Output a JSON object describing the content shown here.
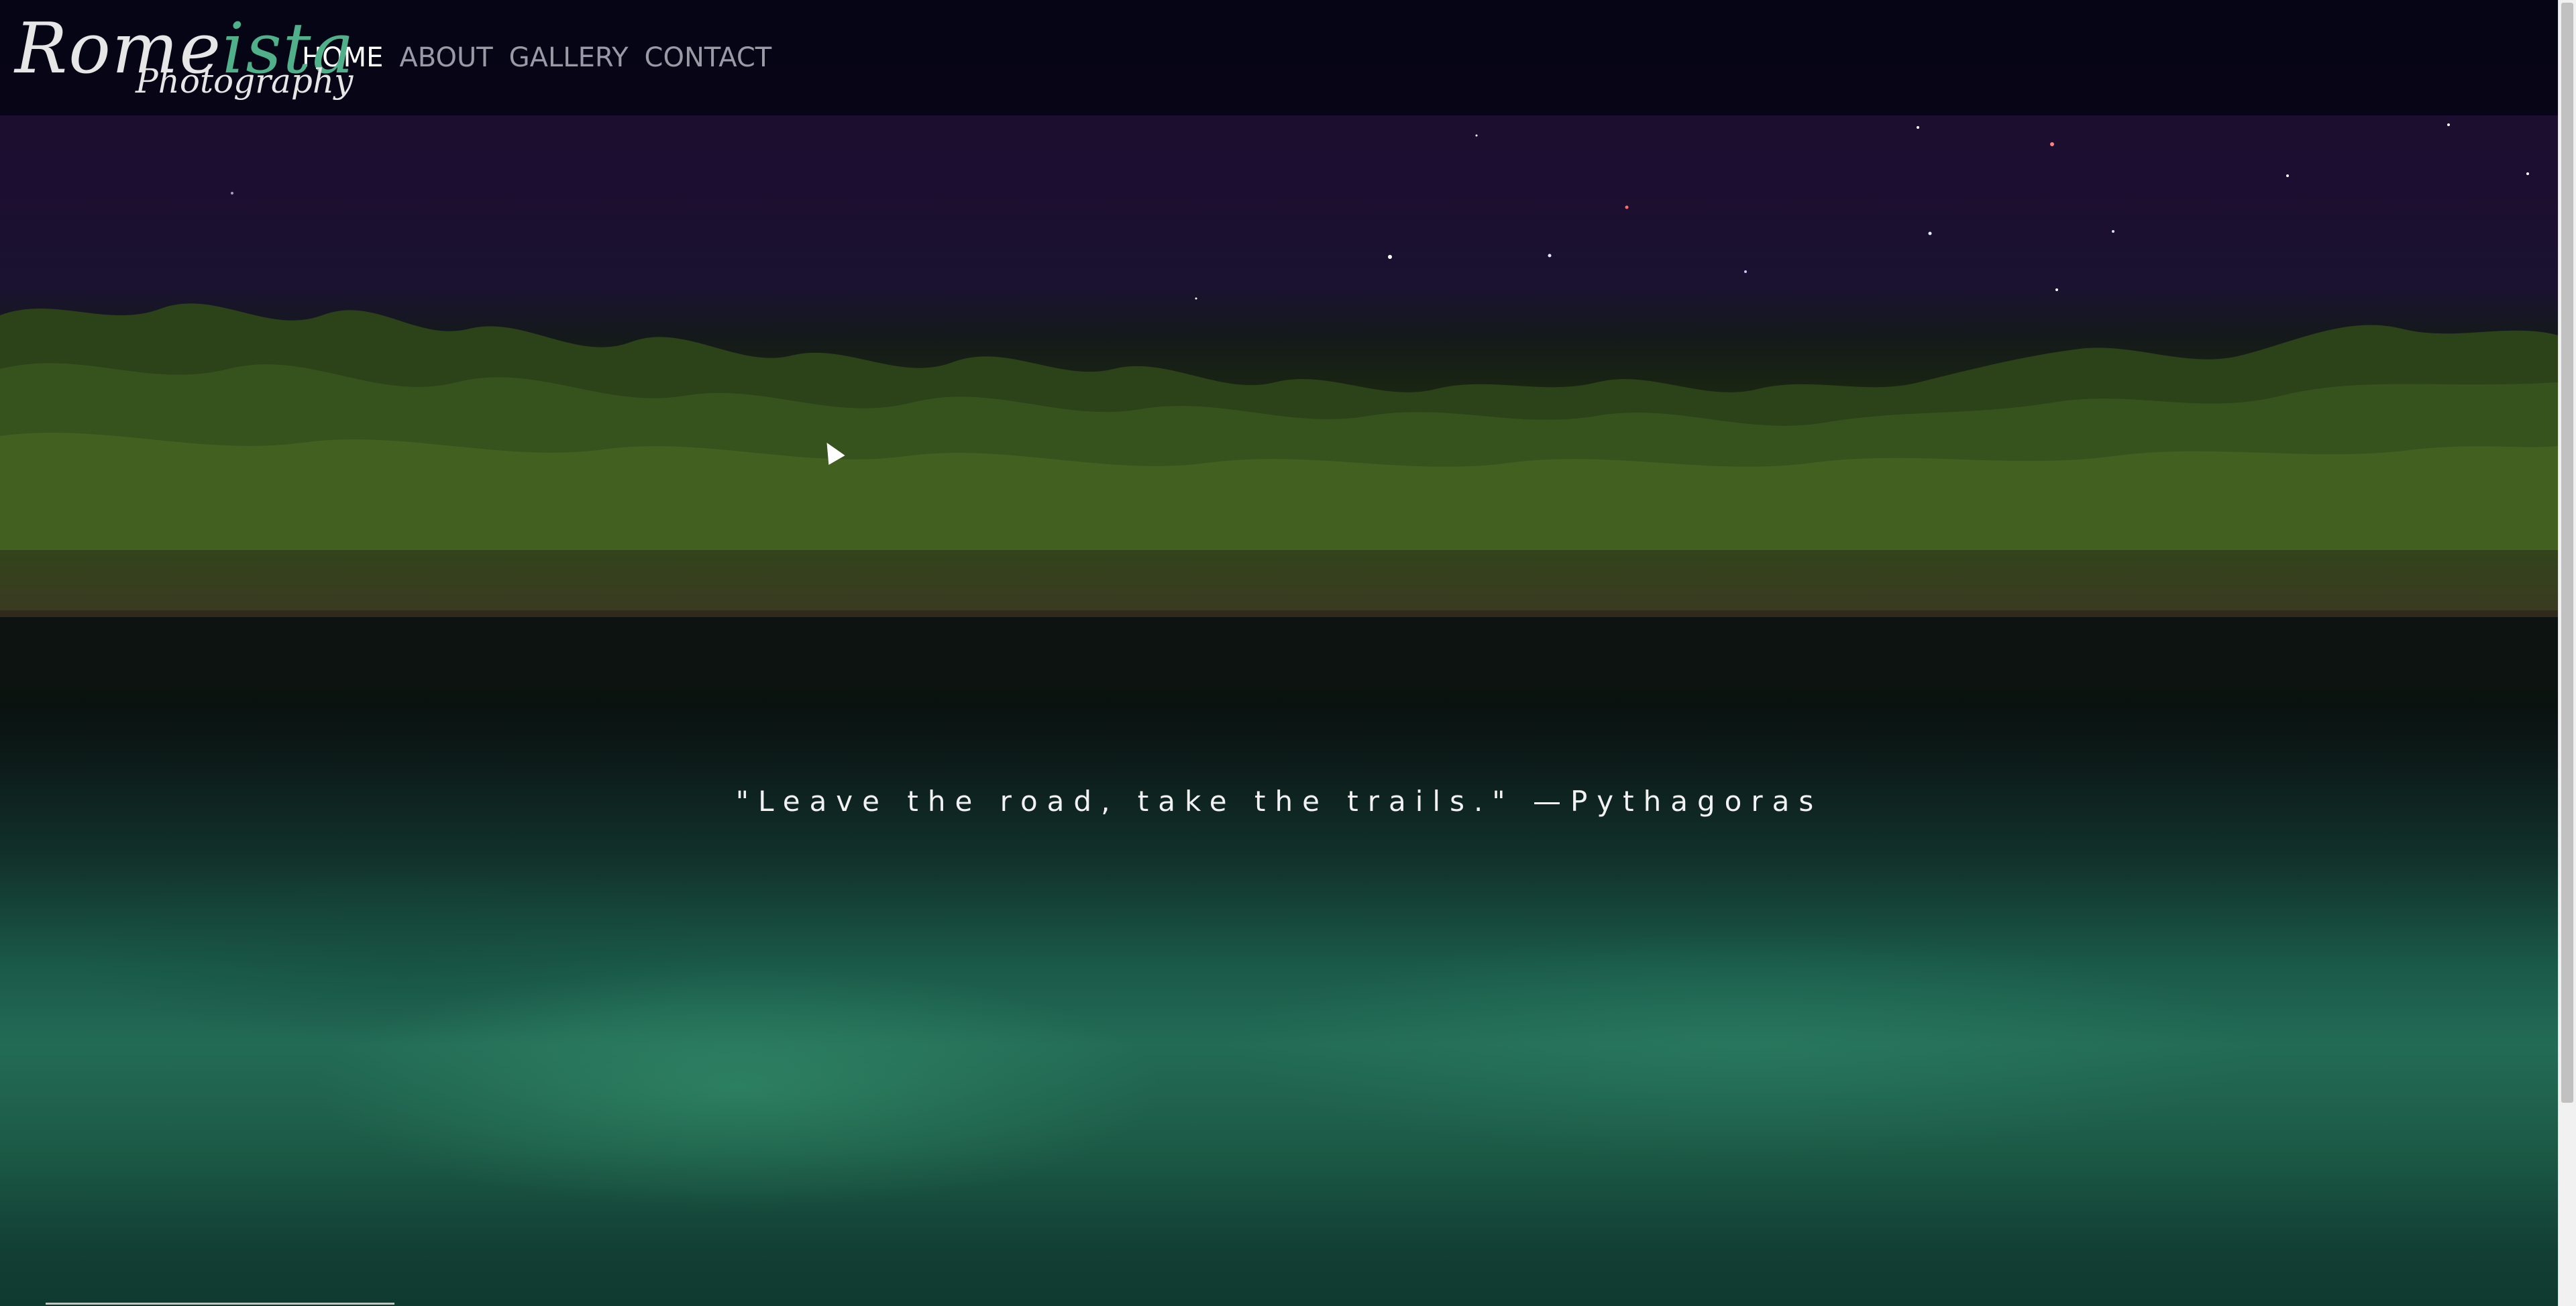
{
  "brand": {
    "logo_main_a": "Rome",
    "logo_main_b": "ista",
    "logo_sub": "Photography"
  },
  "nav": {
    "items": [
      {
        "label": "HOME",
        "active": true
      },
      {
        "label": "ABOUT",
        "active": false
      },
      {
        "label": "GALLERY",
        "active": false
      },
      {
        "label": "CONTACT",
        "active": false
      }
    ]
  },
  "hero": {
    "quote": "\"Leave the road, take the trails.\" —Pythagoras"
  },
  "colors": {
    "navbar_bg": "#06051a",
    "accent_green": "#4fb08a",
    "nav_active": "#ffffff",
    "nav_inactive": "#9a9aa6"
  }
}
